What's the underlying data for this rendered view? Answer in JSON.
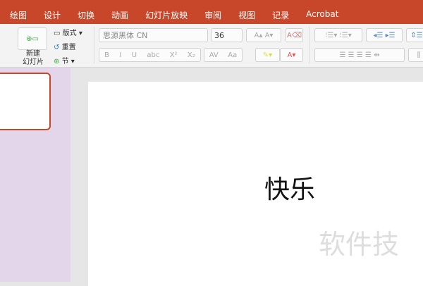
{
  "ribbon_tabs": [
    "绘图",
    "设计",
    "切换",
    "动画",
    "幻灯片放映",
    "审阅",
    "视图",
    "记录",
    "Acrobat"
  ],
  "slides_group": {
    "new_slide": "新建\n幻灯片",
    "layout": "版式",
    "reset": "重置",
    "section": "节"
  },
  "font": {
    "name": "思源黑体 CN",
    "size": "36"
  },
  "format_buttons": [
    "B",
    "I",
    "U",
    "abc",
    "X²",
    "X₂",
    "AV",
    "Aa"
  ],
  "slide": {
    "title": "快乐"
  },
  "watermark": "软件技",
  "colors": {
    "accent": "#c8472a",
    "pane": "#e3d5ea"
  }
}
